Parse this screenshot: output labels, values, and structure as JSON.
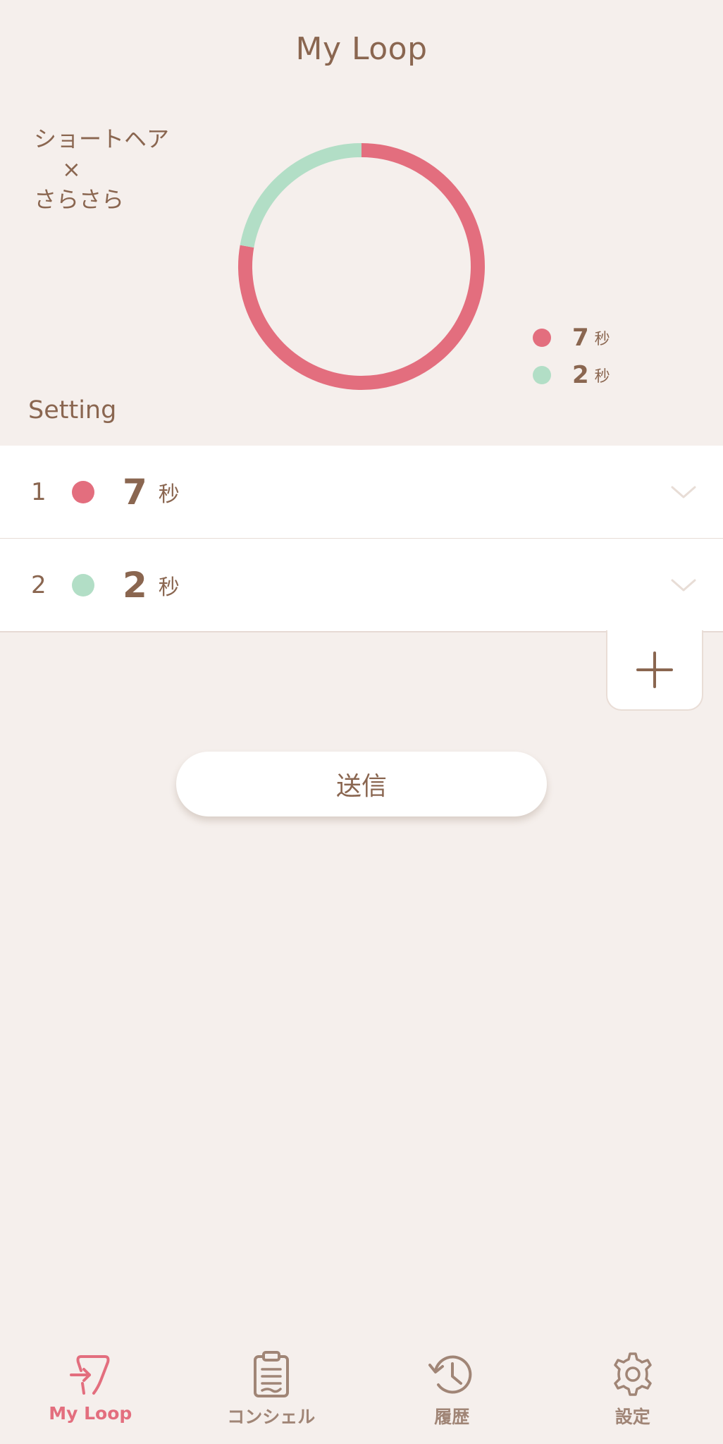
{
  "header": {
    "title": "My Loop"
  },
  "mode": {
    "line1": "ショートヘア",
    "line2": "×",
    "line3": "さらさら"
  },
  "chart_data": {
    "type": "pie",
    "style": "donut",
    "categories": [
      "1",
      "2"
    ],
    "values": [
      7,
      2
    ],
    "unit": "秒",
    "colors": [
      "#e36e7e",
      "#b2dec6"
    ],
    "start": "top",
    "direction": "clockwise",
    "legend_position": "right-bottom"
  },
  "legend": {
    "items": [
      {
        "value": "7",
        "unit": "秒",
        "color": "#e36e7e"
      },
      {
        "value": "2",
        "unit": "秒",
        "color": "#b2dec6"
      }
    ]
  },
  "setting": {
    "label": "Setting",
    "items": [
      {
        "index": "1",
        "value": "7",
        "unit": "秒",
        "color": "#e36e7e"
      },
      {
        "index": "2",
        "value": "2",
        "unit": "秒",
        "color": "#b2dec6"
      }
    ]
  },
  "actions": {
    "add_icon": "plus-icon",
    "send_label": "送信"
  },
  "tabbar": {
    "items": [
      {
        "label": "My Loop",
        "icon": "my-loop-icon",
        "active": true
      },
      {
        "label": "コンシェル",
        "icon": "clipboard-icon",
        "active": false
      },
      {
        "label": "履歴",
        "icon": "history-icon",
        "active": false
      },
      {
        "label": "設定",
        "icon": "gear-icon",
        "active": false
      }
    ]
  },
  "colors": {
    "background": "#f5efec",
    "text": "#8a6650",
    "accent": "#e36e7e",
    "secondary": "#b2dec6",
    "inactive_tab": "#a08576"
  }
}
